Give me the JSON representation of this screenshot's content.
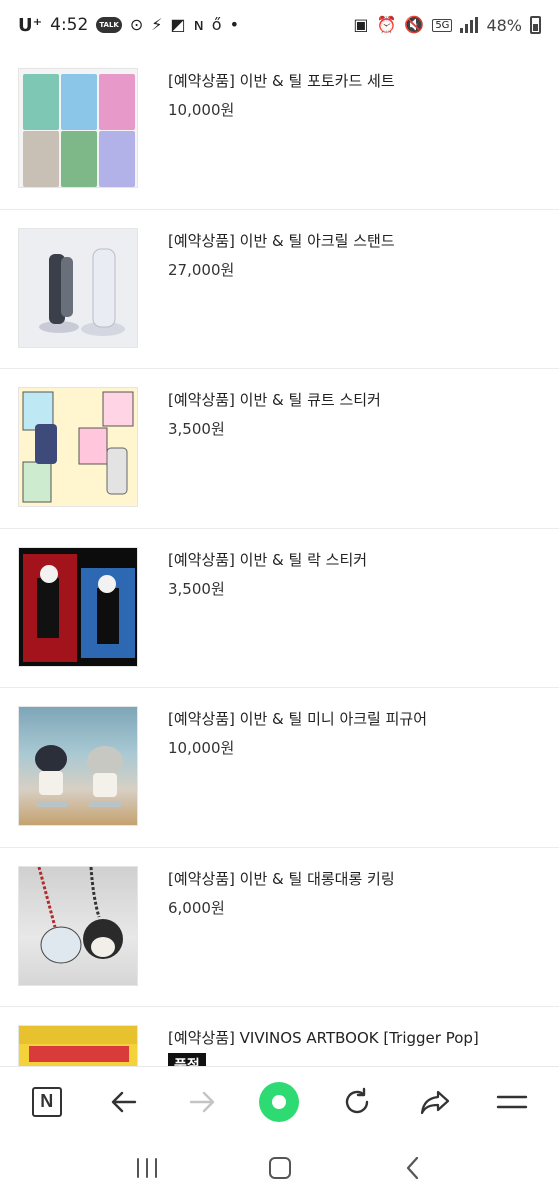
{
  "status_bar": {
    "carrier": "U⁺",
    "time": "4:52",
    "talk_label": "TALK",
    "network": "5G",
    "battery_percent": "48%"
  },
  "products": [
    {
      "name": "[예약상품] 이반 & 틸 포토카드 세트",
      "price": "10,000원"
    },
    {
      "name": "[예약상품] 이반 & 틸 아크릴 스탠드",
      "price": "27,000원"
    },
    {
      "name": "[예약상품] 이반 & 틸 큐트 스티커",
      "price": "3,500원"
    },
    {
      "name": "[예약상품] 이반 & 틸 락 스티커",
      "price": "3,500원"
    },
    {
      "name": "[예약상품] 이반 & 틸 미니 아크릴 피규어",
      "price": "10,000원"
    },
    {
      "name": "[예약상품] 이반 & 틸 대롱대롱 키링",
      "price": "6,000원"
    },
    {
      "name": "[예약상품] VIVINOS ARTBOOK [Trigger Pop]",
      "badge": "품절"
    }
  ],
  "toolbar": {
    "home_label": "N",
    "icons": [
      "naver-home-icon",
      "back-arrow-icon",
      "forward-arrow-icon",
      "green-dot-icon",
      "refresh-icon",
      "share-icon",
      "menu-icon"
    ]
  },
  "navbar": {
    "icons": [
      "recent-apps-icon",
      "home-icon",
      "back-icon"
    ]
  },
  "colors": {
    "accent_green": "#2edb73",
    "soldout_bg": "#111111"
  }
}
